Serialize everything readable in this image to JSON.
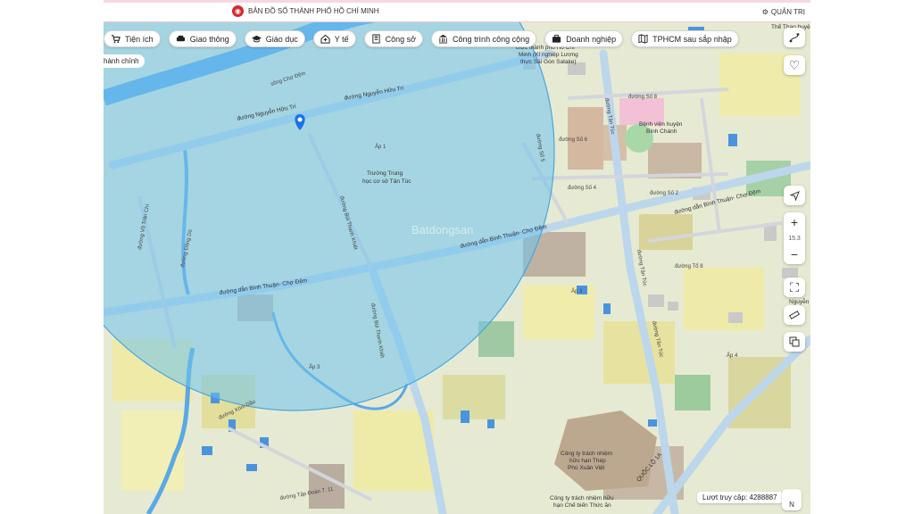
{
  "header": {
    "title": "BẢN ĐỒ SỐ THÀNH PHỐ HỒ CHÍ MINH",
    "admin_label": "QUẢN TRỊ"
  },
  "chips": [
    {
      "label": "Tiện ích",
      "icon": "cart-icon"
    },
    {
      "label": "Giao thông",
      "icon": "car-icon"
    },
    {
      "label": "Giáo dục",
      "icon": "graduation-cap-icon"
    },
    {
      "label": "Y tế",
      "icon": "hospital-icon"
    },
    {
      "label": "Công sở",
      "icon": "office-icon"
    },
    {
      "label": "Công trình công cộng",
      "icon": "public-building-icon"
    },
    {
      "label": "Doanh nghiệp",
      "icon": "briefcase-icon"
    },
    {
      "label": "TPHCM sau sắp nhập",
      "icon": "map-fold-icon"
    }
  ],
  "secondary_chip": "hành chính",
  "zoom_level": "15.3",
  "visit_counter": "Lượt truy cập: 4288887",
  "compass_label": "N",
  "watermark": "Batdongsan",
  "map_labels": {
    "song_cho_dem": "sông Chợ Đệm",
    "nguyen_huu_tri": "đường Nguyễn Hữu Trí",
    "binh_thuan_cho_dem": "đường dẫn Bình Thuận- Chợ Đệm",
    "bui_thanh_khiet": "đường Bùi Thanh Khiết",
    "vo_tran_chi": "đường Võ Trần Chí",
    "dong_du": "đường Đồng Dù",
    "tan_tuc": "đường Tân Túc",
    "so_8": "đường Số 8",
    "so_6": "đường Số 6",
    "so_4": "đường Số 4",
    "so_2": "đường Số 2",
    "so_5": "đường Số 5",
    "to_8": "đường Tổ 8",
    "quoc_lo_1a": "QUỐC LỘ 1A",
    "tap_doan": "đường Tập Đoàn 7, 11",
    "xom_dau": "đường Xóm Dầu",
    "ap_1": "Ấp 1",
    "ap_3": "Ấp 3",
    "ap_4": "Ấp 4",
    "truong_trung_hoc": [
      "Trường Trung",
      "học cơ sở Tân Túc"
    ],
    "benh_vien": [
      "Bệnh viện huyện",
      "Bình Chánh"
    ],
    "cong_ty_thep": [
      "Công ty trách nhiệm",
      "hữu hạn Thép",
      "Phú Xuân Việt"
    ],
    "cong_ty_che_bien": [
      "Công ty trách nhiệm hữu",
      "hạn Chế biến Thức ăn"
    ],
    "luong_thuc": [
      "thực thành phố Hồ Chí",
      "Minh (Xí nghiệp Lương",
      "thực Sài Gòn Satake)"
    ],
    "the_thao": "Thể Thao huyện",
    "nguyen_short": "Nguyễn"
  },
  "colors": {
    "radius_fill": "#6fc2ee",
    "radius_stroke": "#4aa6dc",
    "river": "#5aa8e6",
    "marker": "#1a73e8",
    "brand_red": "#d9262b"
  }
}
